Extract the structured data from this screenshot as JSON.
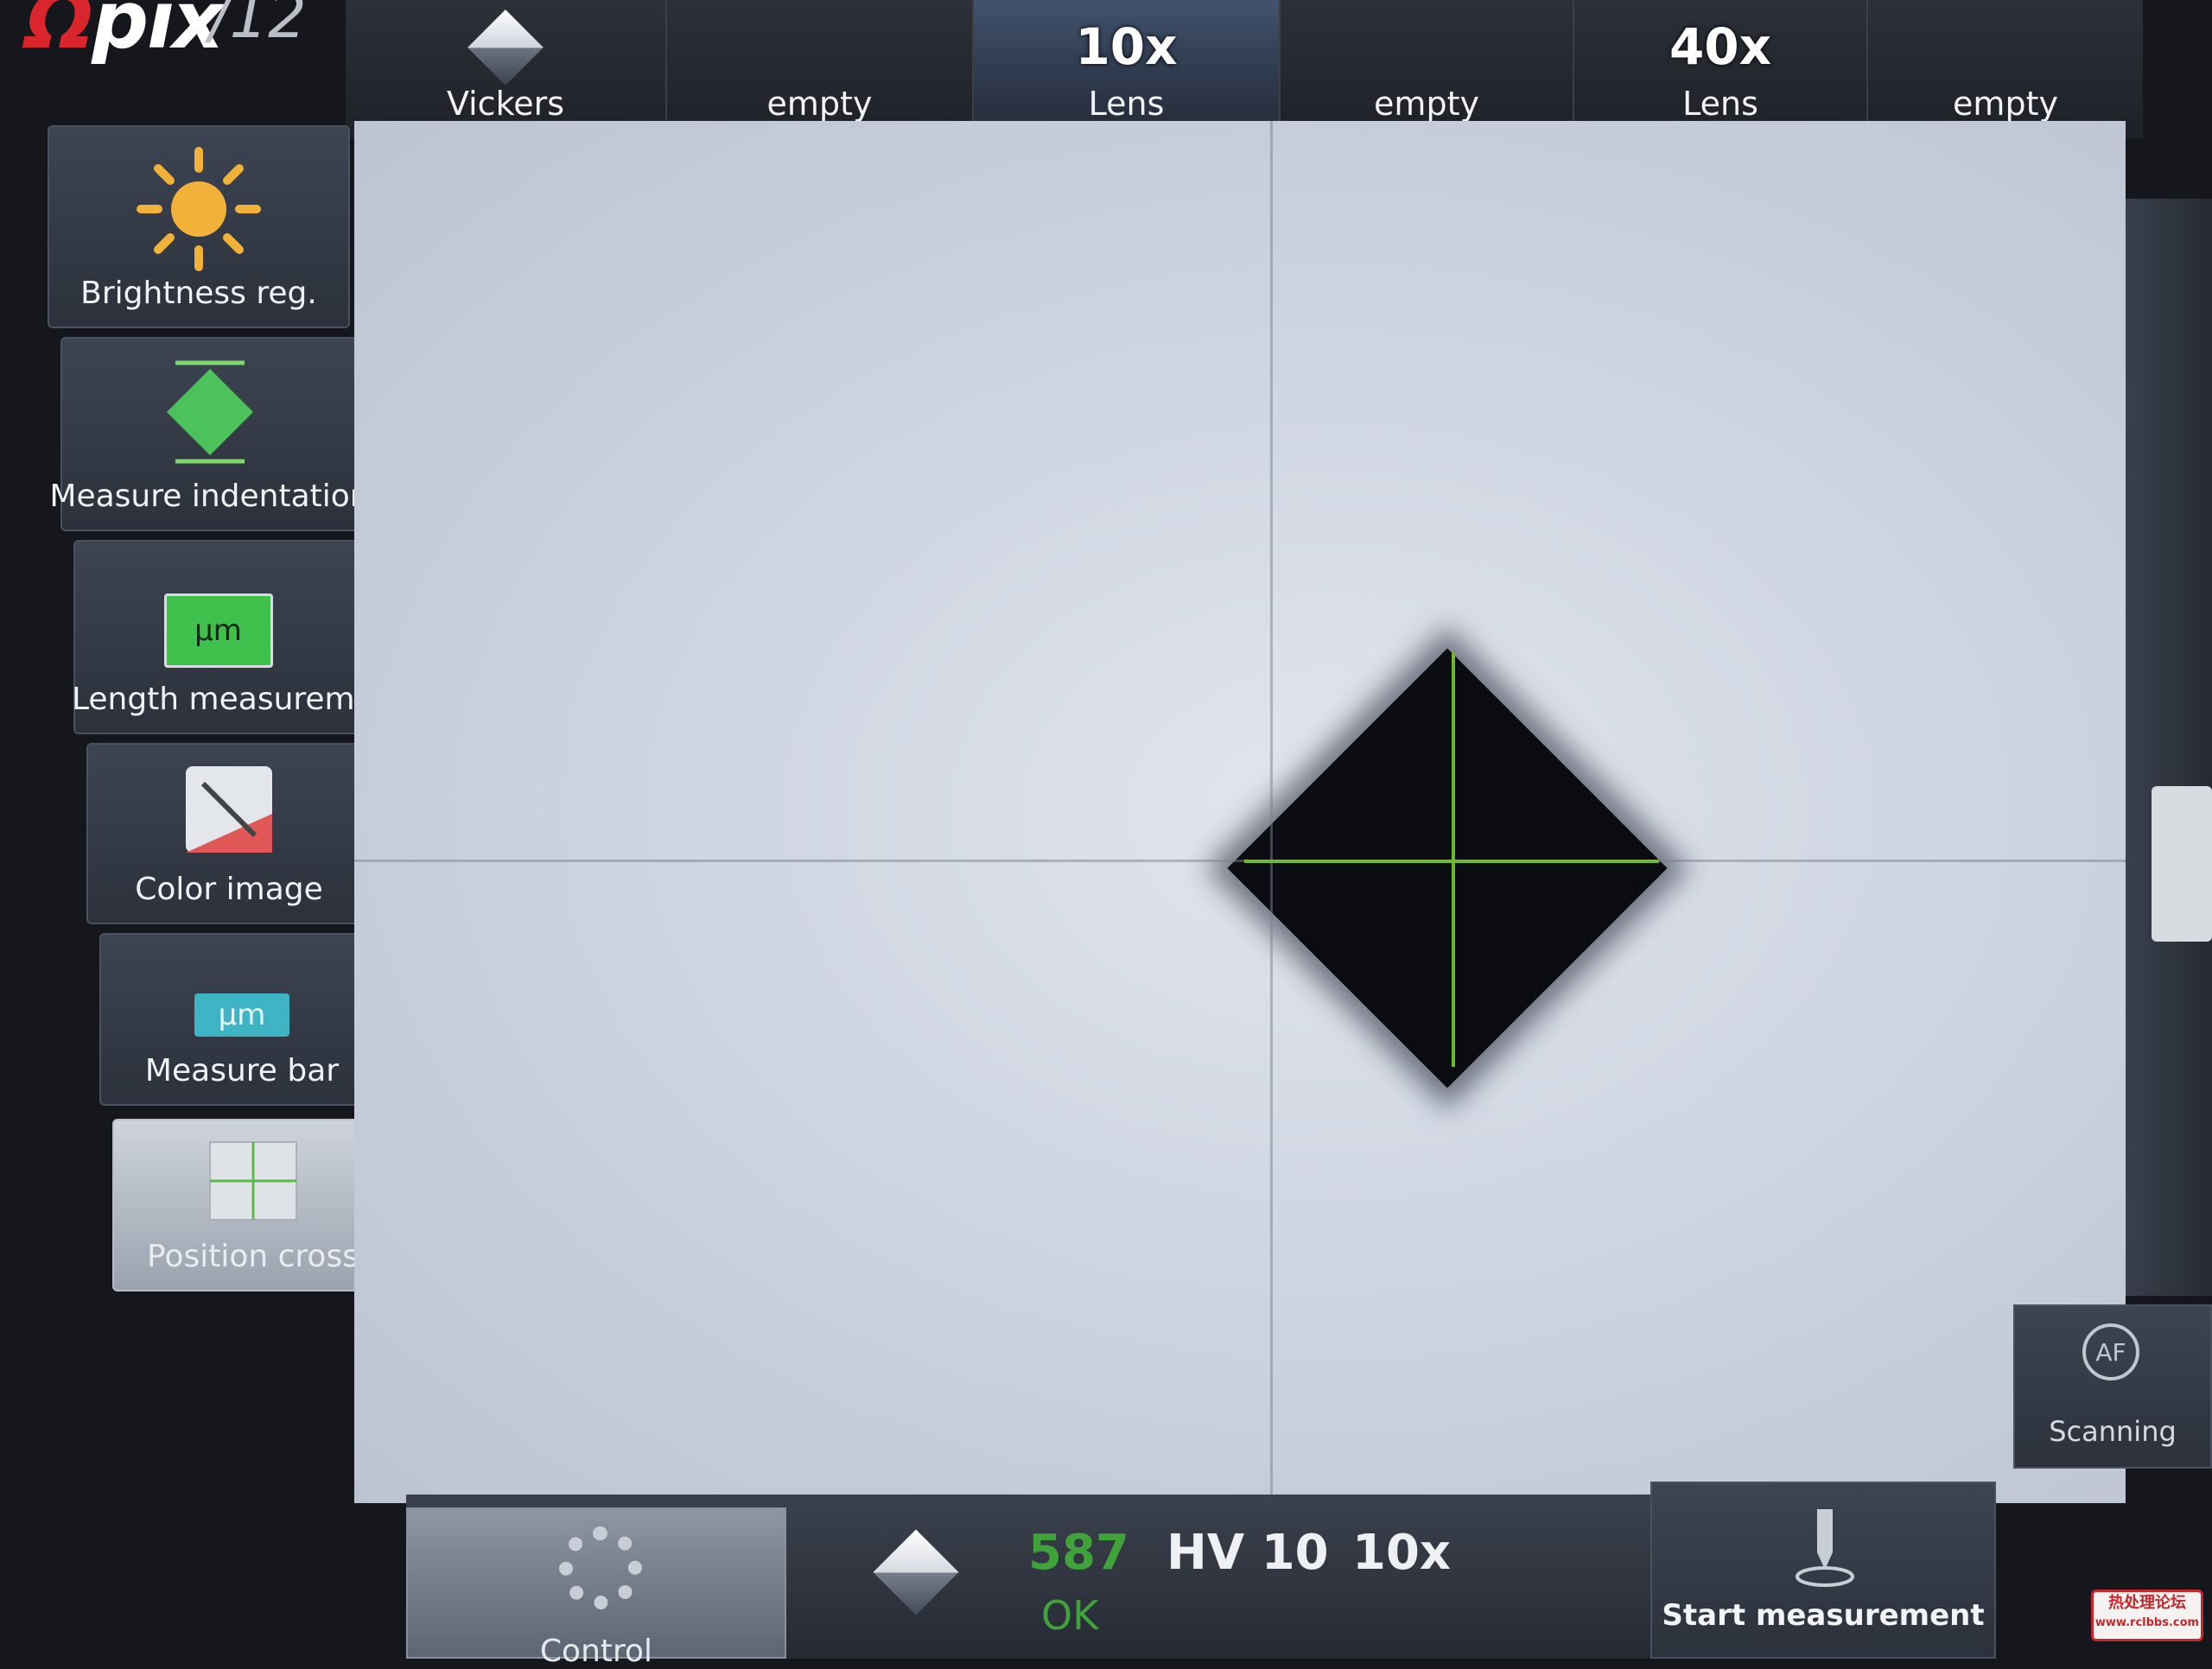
{
  "app": {
    "logo_mark": "Ω",
    "logo_name": "pix",
    "version": "12"
  },
  "toolbar": {
    "buttons": [
      {
        "label": "Vickers",
        "magnification": "",
        "active": false
      },
      {
        "label": "empty",
        "magnification": "",
        "active": false
      },
      {
        "label": "Lens",
        "magnification": "10x",
        "active": true
      },
      {
        "label": "empty",
        "magnification": "",
        "active": false
      },
      {
        "label": "Lens",
        "magnification": "40x",
        "active": false
      },
      {
        "label": "empty",
        "magnification": "",
        "active": false
      }
    ]
  },
  "sidebar": {
    "items": [
      {
        "label": "Brightness reg.",
        "icon": "sun-icon"
      },
      {
        "label": "Measure indentation",
        "icon": "diamond-icon"
      },
      {
        "label": "Length measurem.",
        "icon": "ruler-um-icon",
        "icon_text": "µm"
      },
      {
        "label": "Color image",
        "icon": "color-image-icon"
      },
      {
        "label": "Measure bar",
        "icon": "measure-bar-icon",
        "icon_text": "µm"
      },
      {
        "label": "Position cross",
        "icon": "position-cross-icon"
      }
    ]
  },
  "right_panel": {
    "scanning_label": "Scanning",
    "af_label": "AF"
  },
  "bottom": {
    "control_label": "Control",
    "result_value": "587",
    "hardness_scale": "HV 10",
    "magnification": "10x",
    "status": "OK",
    "start_label": "Start measurement"
  },
  "watermark": {
    "line1": "热处理论坛",
    "line2": "www.rclbbs.com"
  },
  "colors": {
    "accent_green": "#6dbb2a",
    "result_green": "#3fa33a",
    "logo_red": "#d9252b"
  }
}
